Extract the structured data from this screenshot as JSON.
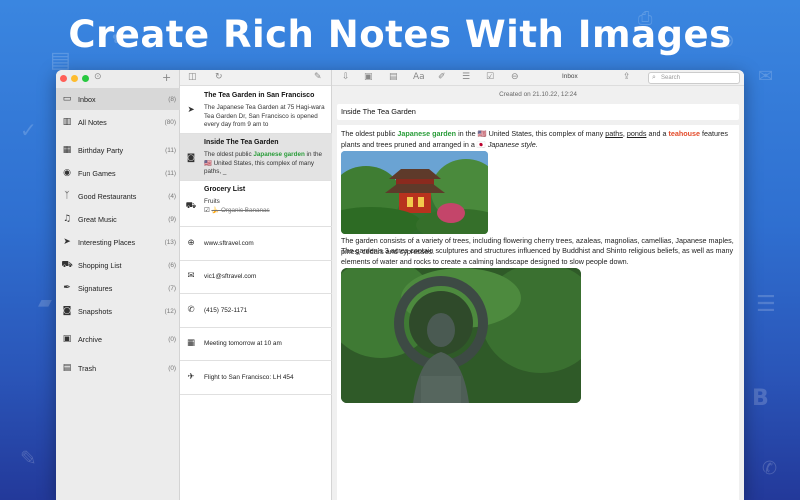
{
  "hero_title": "Create Rich Notes With Images",
  "colors": {
    "background_top": "#3a86e0",
    "background_bottom": "#23399a",
    "accent_green": "#2a9d3a",
    "accent_orange": "#e34b2a"
  },
  "sidebar": {
    "items": [
      {
        "icon": "inbox-icon",
        "label": "Inbox",
        "count": "(8)",
        "active": true
      },
      {
        "icon": "notes-icon",
        "label": "All Notes",
        "count": "(80)"
      },
      {
        "icon": "calendar-icon",
        "label": "Birthday Party",
        "count": "(11)"
      },
      {
        "icon": "gamepad-icon",
        "label": "Fun Games",
        "count": "(11)"
      },
      {
        "icon": "restaurant-icon",
        "label": "Good Restaurants",
        "count": "(4)"
      },
      {
        "icon": "music-icon",
        "label": "Great Music",
        "count": "(9)"
      },
      {
        "icon": "location-icon",
        "label": "Interesting Places",
        "count": "(13)"
      },
      {
        "icon": "cart-icon",
        "label": "Shopping List",
        "count": "(6)"
      },
      {
        "icon": "signature-icon",
        "label": "Signatures",
        "count": "(7)"
      },
      {
        "icon": "camera-icon",
        "label": "Snapshots",
        "count": "(12)"
      },
      {
        "icon": "archive-icon",
        "label": "Archive",
        "count": "(0)"
      },
      {
        "icon": "trash-icon",
        "label": "Trash",
        "count": "(0)"
      }
    ]
  },
  "notes": {
    "n1": {
      "title": "The Tea Garden in San Francisco",
      "body": "The Japanese Tea Garden at 75 Hagi-wara Tea Garden Dr, San Francisco is opened every day from 9 am to"
    },
    "n2": {
      "title": "Inside The Tea Garden",
      "body_a": "The oldest public ",
      "body_green": "Japanese garden",
      "body_b": " in the 🇺🇸 United States, this complex of many paths, _"
    },
    "n3": {
      "title": "Grocery List",
      "line1": "Fruits",
      "line2": "🍌 Organic Bananas"
    },
    "n4": "www.sftravel.com",
    "n5": "vic1@sftravel.com",
    "n6": "(415) 752-1171",
    "n7": "Meeting tomorrow at 10 am",
    "n8": "Flight to San Francisco: LH 454"
  },
  "editor": {
    "toolbar_title": "Inbox",
    "search_placeholder": "Search",
    "created": "Created on 21.10.22, 12:24",
    "title": "Inside The Tea Garden",
    "p1_a": "The oldest public ",
    "p1_green": "Japanese garden",
    "p1_b": " in the 🇺🇸 United States, this complex of many ",
    "p1_paths": "paths",
    "p1_c": ", ",
    "p1_ponds": "ponds",
    "p1_d": " and a ",
    "p1_orange": "teahouse",
    "p1_e": " features plants and trees pruned and arranged in a 🇯🇵 ",
    "p1_italic": "Japanese style.",
    "p2": "The garden consists of a variety of trees, including flowering cherry trees, azaleas, magnolias, camellias, Japanese maples, pines, cedars and cypresses.",
    "p3": "The garden's 3 acres contain sculptures and structures influenced by Buddhist and Shinto religious beliefs, as well as many elements of water and rocks to create a calming landscape designed to slow people down."
  }
}
